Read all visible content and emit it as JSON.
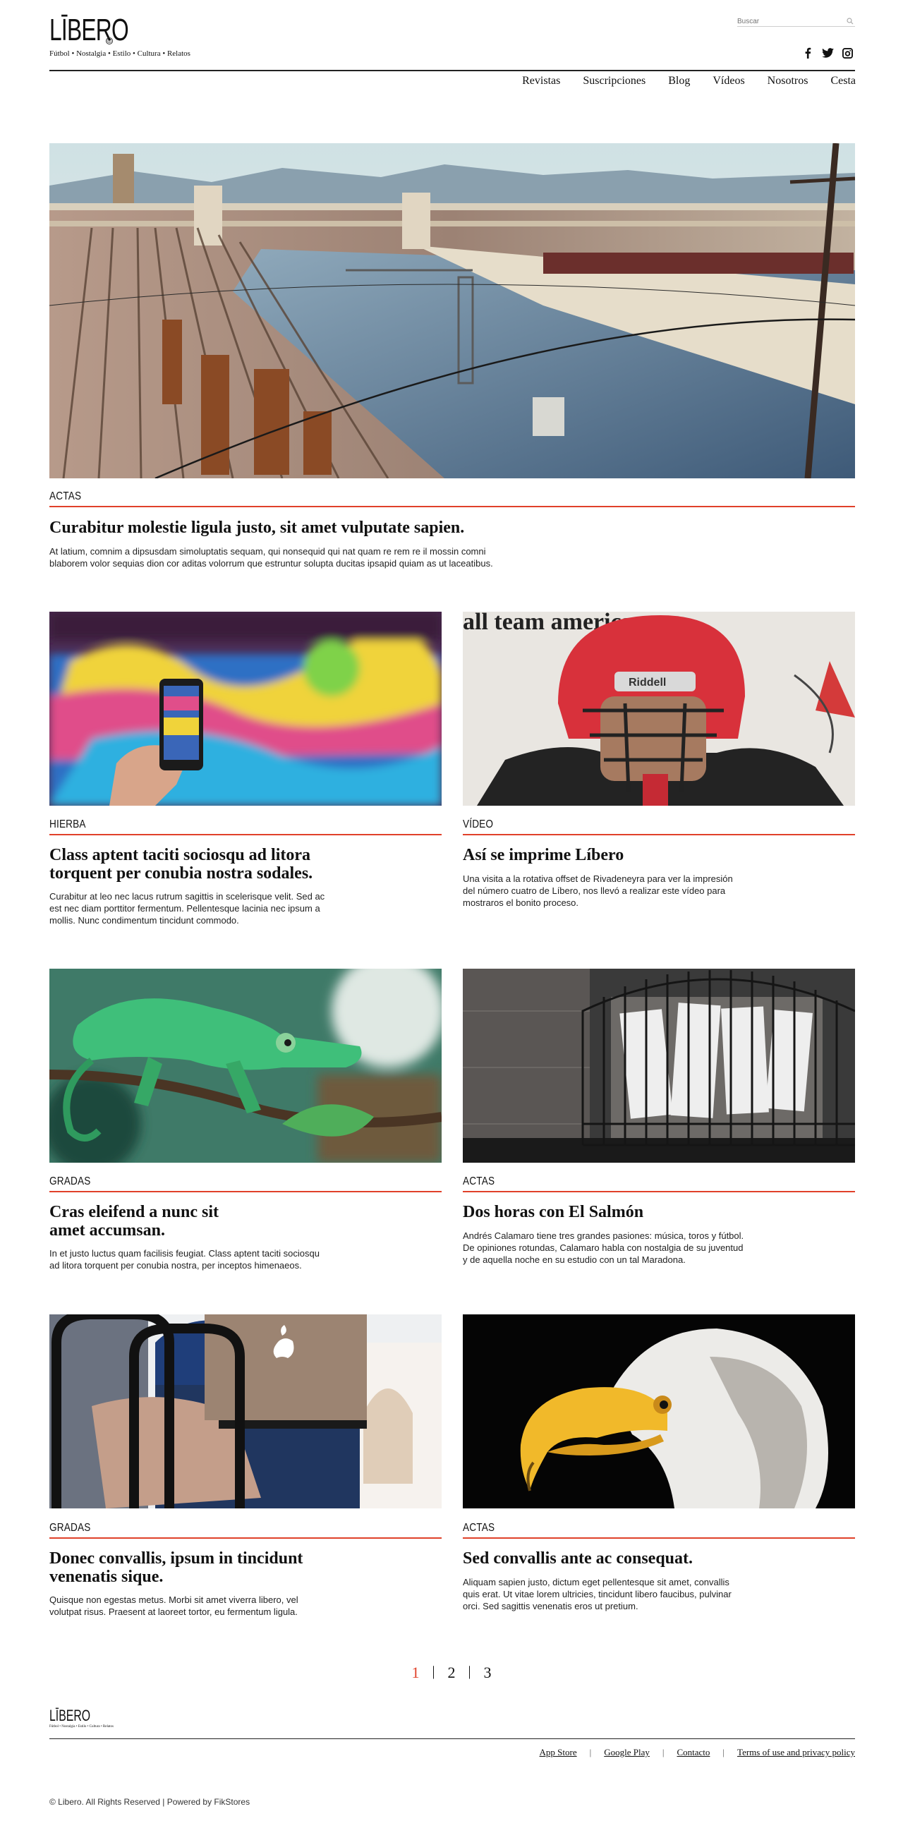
{
  "header": {
    "logo_text": "LĪBERO",
    "logo_mark": "®",
    "tagline": "Fútbol • Nostalgia • Estilo • Cultura • Relatos",
    "search_placeholder": "Buscar",
    "nav": [
      "Revistas",
      "Suscripciones",
      "Blog",
      "Vídeos",
      "Nosotros",
      "Cesta"
    ]
  },
  "hero": {
    "category": "ACTAS",
    "title": "Curabitur molestie ligula justo, sit amet vulputate sapien.",
    "excerpt_1": "At latium, comnim a dipsusdam simoluptatis sequam, qui nonsequid qui nat quam re rem re il mossin comni",
    "excerpt_2": "blaborem volor sequias dion cor aditas volorrum que estruntur solupta ducitas ipsapid quiam as ut laceatibus."
  },
  "cards": [
    {
      "category": "HIERBA",
      "title_1": "Class aptent taciti sociosqu ad litora",
      "title_2": "torquent per conubia nostra sodales.",
      "ex_1": "Curabitur at leo nec lacus rutrum sagittis in scelerisque velit. Sed ac",
      "ex_2": "est nec diam porttitor fermentum. Pellentesque lacinia nec ipsum a",
      "ex_3": "mollis. Nunc condimentum tincidunt commodo."
    },
    {
      "category": "VÍDEO",
      "title_1": "Así se imprime Líbero",
      "title_2": "",
      "ex_1": "Una visita a la rotativa offset de Rivadeneyra para ver la impresión",
      "ex_2": "del número cuatro de Líbero, nos llevó a realizar este vídeo para",
      "ex_3": "mostraros el bonito proceso."
    },
    {
      "category": "GRADAS",
      "title_1": "Cras eleifend a nunc sit",
      "title_2": "amet accumsan.",
      "ex_1": "In et justo luctus quam facilisis feugiat. Class aptent taciti sociosqu",
      "ex_2": "ad litora torquent per conubia nostra, per inceptos himenaeos.",
      "ex_3": ""
    },
    {
      "category": "ACTAS",
      "title_1": "Dos horas con El Salmón",
      "title_2": "",
      "ex_1": "Andrés Calamaro tiene tres grandes pasiones: música, toros y fútbol.",
      "ex_2": "De opiniones rotundas, Calamaro habla con nostalgia de su juventud",
      "ex_3": "y de aquella noche en su estudio con un tal Maradona."
    },
    {
      "category": "GRADAS",
      "title_1": "Donec convallis, ipsum in tincidunt",
      "title_2": "venenatis sique.",
      "ex_1": "Quisque non egestas metus. Morbi sit amet viverra libero, vel",
      "ex_2": "volutpat risus. Praesent at laoreet tortor, eu fermentum ligula.",
      "ex_3": ""
    },
    {
      "category": "ACTAS",
      "title_1": "Sed convallis ante ac consequat.",
      "title_2": "",
      "ex_1": "Aliquam sapien justo, dictum eget pellentesque sit amet, convallis",
      "ex_2": "quis erat. Ut vitae lorem ultricies, tincidunt libero faucibus, pulvinar",
      "ex_3": "orci. Sed sagittis venenatis eros ut pretium."
    }
  ],
  "card_images": [
    {
      "art": "graffiti",
      "bg": "#3a6ec0"
    },
    {
      "art": "helmet",
      "bg": "#e8e6e2"
    },
    {
      "art": "chameleon",
      "bg": "#2e6b55"
    },
    {
      "art": "cage",
      "bg": "#4a4a4a"
    },
    {
      "art": "laptop",
      "bg": "#d9d2c8"
    },
    {
      "art": "eagle",
      "bg": "#050505"
    }
  ],
  "pagination": {
    "pages": [
      "1",
      "2",
      "3"
    ],
    "current": "1",
    "separator": "|"
  },
  "footer": {
    "logo_text": "LĪBERO",
    "tagline": "Fútbol • Nostalgia • Estilo • Cultura • Relatos",
    "links": [
      "App Store",
      "Google Play",
      "Contacto",
      "Terms of use and privacy policy"
    ],
    "separator": "|",
    "copyright": "© Libero. All Rights Reserved | Powered by FikStores"
  },
  "colors": {
    "accent": "#e0412a",
    "text": "#111111",
    "rule": "#222222"
  },
  "icons": {
    "search": "search-icon",
    "social": [
      "facebook-icon",
      "twitter-icon",
      "instagram-icon"
    ]
  }
}
